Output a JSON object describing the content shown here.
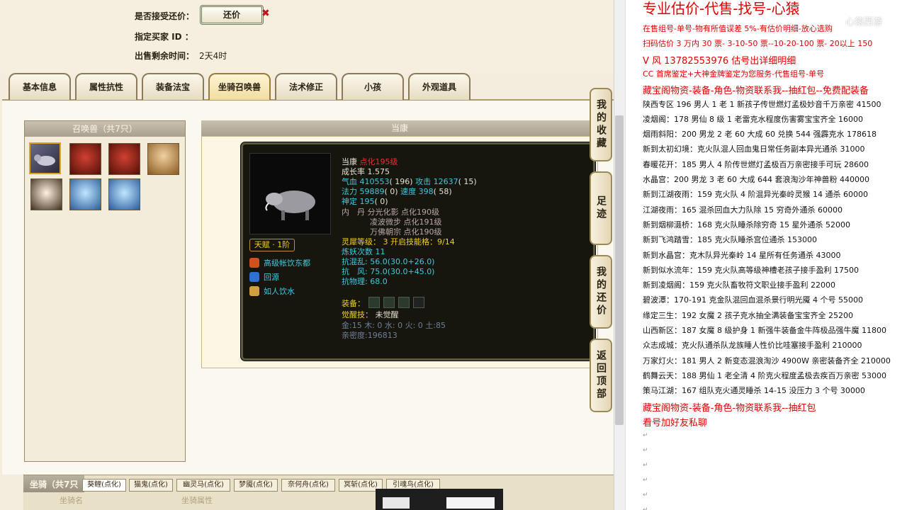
{
  "trade": {
    "accept_counter_label": "是否接受还价：",
    "counter_button": "还价",
    "buyer_label": "指定买家 ID ：",
    "remaining_label": "出售剩余时间：",
    "remaining_value": "2天4时"
  },
  "tabs": [
    "基本信息",
    "属性抗性",
    "装备法宝",
    "坐骑召唤兽",
    "法术修正",
    "小孩",
    "外观道具"
  ],
  "summon": {
    "panel_title": "召唤兽（共7只）",
    "detail_title": "当康"
  },
  "pet": {
    "name": "当康",
    "level": "点化195级",
    "growth": "成长率 1.575",
    "hp_label": "气血",
    "hp": "410553",
    "hp_extra": "( 196)",
    "atk_label": "攻击",
    "atk": "12637",
    "atk_extra": "( 15)",
    "mp_label": "法力",
    "mp": "59889",
    "mp_extra": "( 0)",
    "spd_label": "速度",
    "spd": "398",
    "spd_extra": "( 58)",
    "ding_label": "神定",
    "ding": "195",
    "ding_extra": "( 0)",
    "dan_label": "内　丹",
    "dan1": "分光化影 点化190级",
    "dan2": "凌波微步 点化191级",
    "dan3": "万佛朝宗 点化190级",
    "talent": "天赋 · 1阶",
    "lingxi_label": "灵犀等级：",
    "lingxi_value": "3 开启技能格：9/14",
    "lianyao": "炼妖次数 11",
    "res1": "抗混乱: 56.0(30.0+26.0)",
    "res2": "抗　风: 75.0(30.0+45.0)",
    "res3": "抗物理: 68.0",
    "skills": [
      "高级帐饮东都",
      "回源",
      "如人饮水"
    ],
    "equip_label": "装备：",
    "awaken_label": "觉醒技：",
    "awaken_value": "未觉醒",
    "wuxing": "金:15 木: 0 水: 0 火: 0 土:85",
    "intimacy": "亲密度:196813"
  },
  "bottom": {
    "mount_title": "坐骑（共7只",
    "mount_tabs": [
      "葵鲤(点化)",
      "猫鬼(点化)",
      "幽灵马(点化)",
      "梦魇(点化)",
      "奈何舟(点化)",
      "冥斩(点化)",
      "引魂鸟(点化)"
    ],
    "col_name": "坐骑名",
    "col_attr": "坐骑属性"
  },
  "side_buttons": [
    "我的收藏",
    "足迹",
    "我的还价",
    "返回顶部"
  ],
  "notes": {
    "title": "专业估价-代售-找号-心猿",
    "watermark": "心猿西游",
    "lines": [
      {
        "t": "在售组号-单号-物有所值误差 5%-有估价明细-放心选购",
        "c": "red"
      },
      {
        "t": "扫码估价 3 万内 30 票- 3-10-50 票--10-20-100 票- 20以上 150",
        "c": "red"
      },
      {
        "t": "V 风    13782553976   估号出详细明细",
        "c": "red big"
      },
      {
        "t": "CC 首席鉴定+大神金牌鉴定为您服务-代售组号-单号",
        "c": "red"
      },
      {
        "t": "藏宝阁物资-装备-角色-物资联系我--抽红包--免费配装备",
        "c": "red big"
      },
      {
        "t": "陕西专区 196 男人 1 老 1 新孩子传世燃灯孟极妙音千万亲密 41500",
        "c": ""
      },
      {
        "t": "凌烟阁：178 男仙 8 级 1 老雷克水程度伤害雾宝宝齐全 16000",
        "c": ""
      },
      {
        "t": "烟雨斜阳：200 男龙 2 老 60 大成 60 兑换 544 强霹克水 178618",
        "c": ""
      },
      {
        "t": "新到太初幻境：克火队混人回血鬼日常任务副本异光通杀 31000",
        "c": ""
      },
      {
        "t": "春暖花开：185 男人 4 阶传世燃灯孟极百万亲密接手可玩 28600",
        "c": ""
      },
      {
        "t": "水晶宫：200 男龙 3 老 60 大成 644 套浪淘沙年神兽粉 440000",
        "c": ""
      },
      {
        "t": "新到江湖夜雨：159 克火队 4 阶混异光秦岭灵猴 14 通杀 60000",
        "c": ""
      },
      {
        "t": "江湖夜雨：165 混杀回血大力队除 15 穷奇外通杀 60000",
        "c": ""
      },
      {
        "t": "新到烟柳滠桥：168 克火队睡杀除穷奇 15 星外通杀 52000",
        "c": ""
      },
      {
        "t": "新到飞鸿踏雪：185 克火队睡杀宫位通杀 153000",
        "c": ""
      },
      {
        "t": "新到水晶宫：克木队异光秦岭 14 星所有任务通杀 43000",
        "c": ""
      },
      {
        "t": "新到似水流年：159 克火队高等级神槽老孩子接手盈利 17500",
        "c": ""
      },
      {
        "t": "新到凌烟阁：159 克火队畜牧符文职业接手盈利 22000",
        "c": ""
      },
      {
        "t": "碧波潭：170-191 克金队混回血混杀景行明光魇 4 个号 55000",
        "c": ""
      },
      {
        "t": "缘定三生：192 女魔 2 孩子克水抽全满装备宝宝齐全 25200",
        "c": ""
      },
      {
        "t": "山西新区：187 女魔 8 级护身 1 新强牛装备金牛阵极品强牛魔 11800",
        "c": ""
      },
      {
        "t": "众志成城：克火队通杀队龙族睡人性价比哇塞接手盈利 210000",
        "c": ""
      },
      {
        "t": "万家灯火：181 男人 2 新变态混浪淘沙 4900W 亲密装备齐全 210000",
        "c": ""
      },
      {
        "t": "鹤舞云天：188 男仙 1 老全清 4 阶克火程度孟极去疾百万亲密 53000",
        "c": ""
      },
      {
        "t": "策马江湖：167 组队克火通灵睡杀 14-15 没压力 3 个号 30000",
        "c": ""
      },
      {
        "t": "藏宝阁物资-装备-角色-物资联系我--抽红包",
        "c": "red big"
      },
      {
        "t": "看号加好友私聊",
        "c": "red big"
      }
    ],
    "marks": [
      "↵",
      "↵",
      "↵",
      "↵",
      "↵",
      "↵"
    ]
  },
  "colors": {
    "accent_red": "#e00000",
    "tooltip_bg": "#16160f",
    "panel_bg": "#f4eddd"
  }
}
